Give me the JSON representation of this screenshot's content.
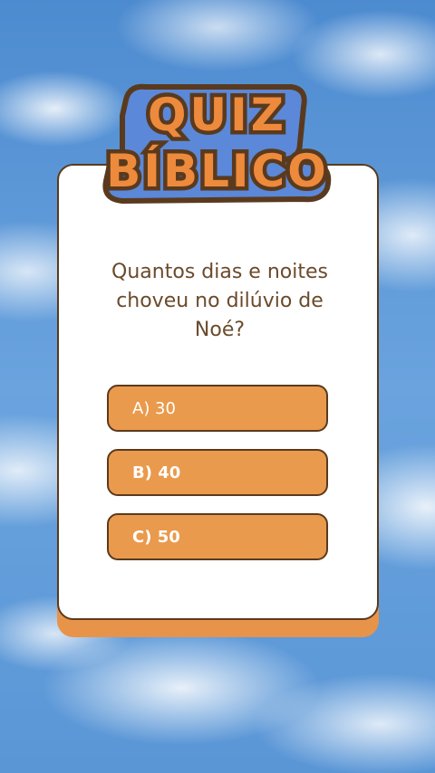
{
  "logo": {
    "line1": "QUIZ",
    "line2": "BÍBLICO"
  },
  "question": {
    "text": "Quantos dias e noites choveu no dilúvio de Noé?"
  },
  "options": [
    {
      "label": "A) 30"
    },
    {
      "label": "B) 40"
    },
    {
      "label": "C) 50"
    }
  ],
  "colors": {
    "accent": "#ea9a4c",
    "outline": "#5a3a1e",
    "logo_back": "#5b88d8",
    "text": "#6b4a2b"
  }
}
